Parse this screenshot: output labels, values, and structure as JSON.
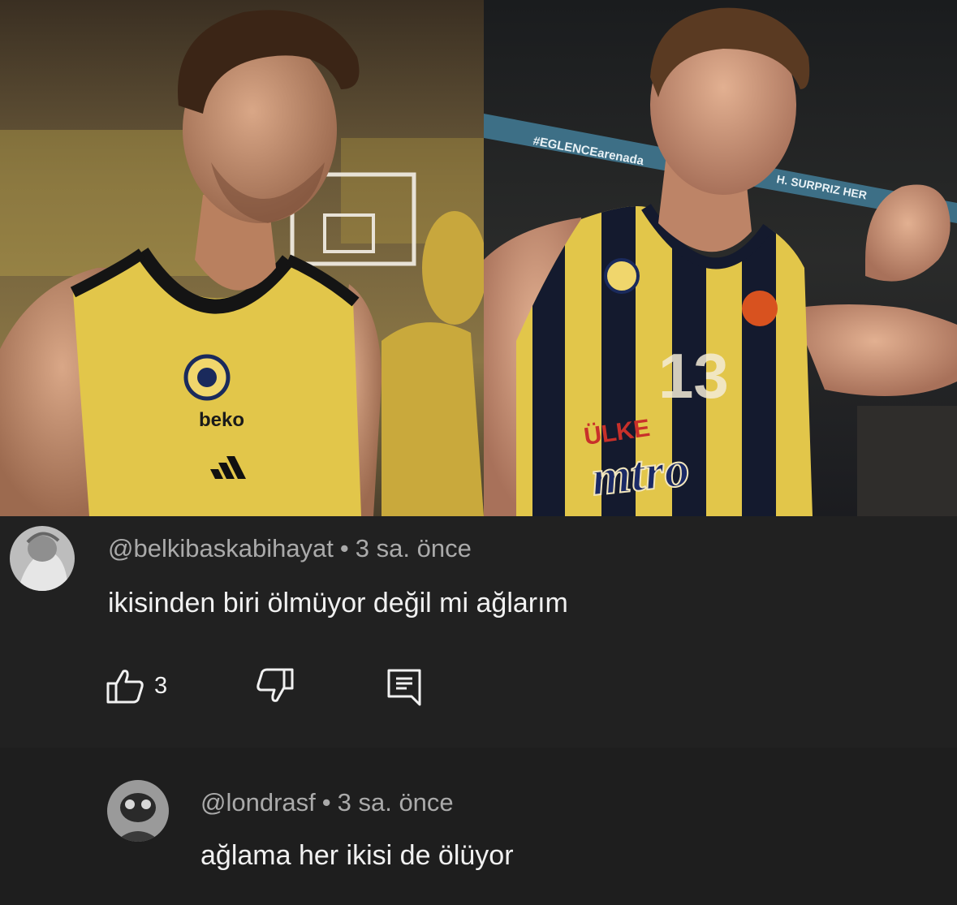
{
  "photos": {
    "left": {
      "jersey_sponsor": "beko"
    },
    "right": {
      "banner_text": "#EGLENCEarenada",
      "banner_text_2": "H. SURPRIZ HER",
      "jersey_number": "13",
      "jersey_sponsor_top": "ÜLKE",
      "jersey_sponsor_main": "mtro"
    }
  },
  "comments": [
    {
      "author": "@belkibaskabihayat",
      "separator": "•",
      "time": "3 sa. önce",
      "text": "ikisinden biri ölmüyor değil mi ağlarım",
      "like_count": "3",
      "icons": {
        "like": "thumbs-up-icon",
        "dislike": "thumbs-down-icon",
        "reply": "reply-icon"
      }
    },
    {
      "author": "@londrasf",
      "separator": "•",
      "time": "3 sa. önce",
      "text": "ağlama her ikisi de ölüyor"
    }
  ],
  "colors": {
    "comment_bg": "#212121",
    "reply_bg": "#1e1e1e",
    "meta_text": "#aaaaaa",
    "body_text": "#f1f1f1",
    "jersey_yellow": "#e2c64a",
    "jersey_navy": "#141a2e"
  }
}
